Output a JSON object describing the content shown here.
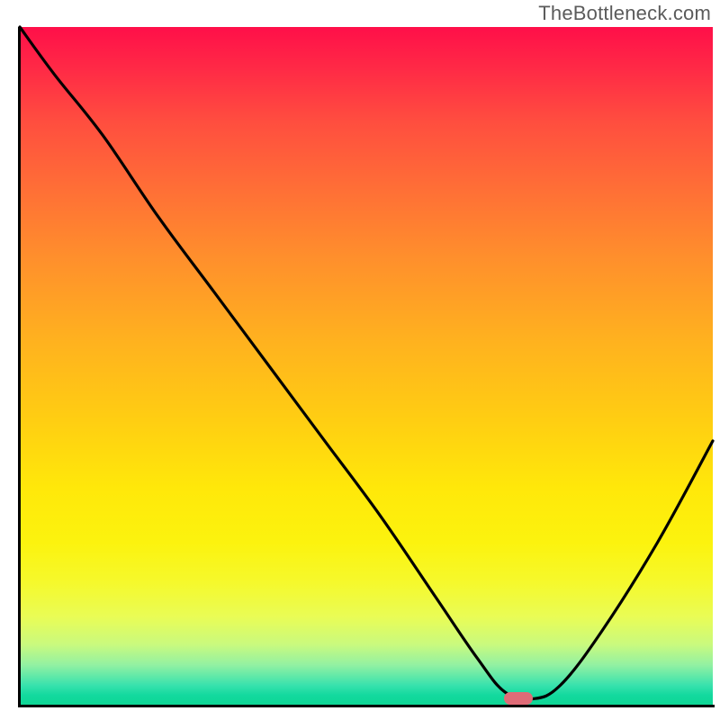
{
  "watermark": "TheBottleneck.com",
  "chart_data": {
    "type": "line",
    "title": "",
    "xlabel": "",
    "ylabel": "",
    "xlim": [
      0,
      100
    ],
    "ylim": [
      0,
      100
    ],
    "notes": "Background is a vertical gradient from red (top, high bottleneck) through orange/yellow to green (bottom, low bottleneck). Black curve starts at top-left, descends steeply, reaches a minimum near x≈72, then rises toward the right edge.",
    "series": [
      {
        "name": "bottleneck-curve",
        "x": [
          0,
          5,
          12,
          20,
          28,
          36,
          44,
          52,
          60,
          66,
          70,
          74,
          78,
          84,
          92,
          100
        ],
        "values": [
          100,
          93,
          84,
          72,
          61,
          50,
          39,
          28,
          16,
          7,
          2,
          1,
          3,
          11,
          24,
          39
        ]
      }
    ],
    "marker": {
      "x": 72,
      "y": 1,
      "label": "optimal-point"
    },
    "gradient_stops": [
      {
        "pos": 0,
        "color": "#ff0f49"
      },
      {
        "pos": 50,
        "color": "#ffb11f"
      },
      {
        "pos": 80,
        "color": "#fcf30e"
      },
      {
        "pos": 100,
        "color": "#0ed694"
      }
    ]
  }
}
